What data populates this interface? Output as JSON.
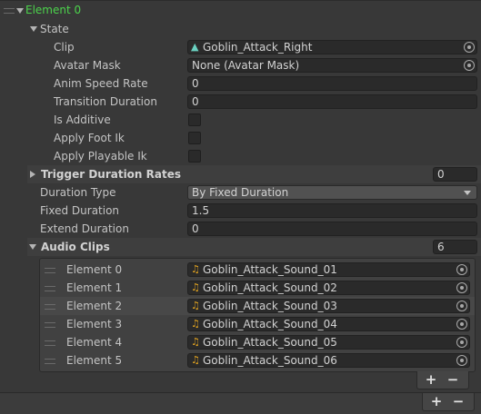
{
  "element": {
    "label": "Element 0",
    "color": "#4cd44c"
  },
  "state": {
    "label": "State",
    "clip": {
      "label": "Clip",
      "value": "Goblin_Attack_Right",
      "icon": "animation-clip-icon"
    },
    "avatar_mask": {
      "label": "Avatar Mask",
      "value": "None (Avatar Mask)"
    },
    "anim_speed_rate": {
      "label": "Anim Speed Rate",
      "value": "0"
    },
    "transition_duration": {
      "label": "Transition Duration",
      "value": "0"
    },
    "is_additive": {
      "label": "Is Additive",
      "checked": false
    },
    "apply_foot_ik": {
      "label": "Apply Foot Ik",
      "checked": false
    },
    "apply_playable_ik": {
      "label": "Apply Playable Ik",
      "checked": false
    }
  },
  "trigger_duration_rates": {
    "label": "Trigger Duration Rates",
    "count": "0"
  },
  "duration_type": {
    "label": "Duration Type",
    "value": "By Fixed Duration"
  },
  "fixed_duration": {
    "label": "Fixed Duration",
    "value": "1.5"
  },
  "extend_duration": {
    "label": "Extend Duration",
    "value": "0"
  },
  "audio_clips": {
    "label": "Audio Clips",
    "count": "6",
    "icon": "audio-clip-icon",
    "items": [
      {
        "label": "Element 0",
        "value": "Goblin_Attack_Sound_01"
      },
      {
        "label": "Element 1",
        "value": "Goblin_Attack_Sound_02"
      },
      {
        "label": "Element 2",
        "value": "Goblin_Attack_Sound_03"
      },
      {
        "label": "Element 3",
        "value": "Goblin_Attack_Sound_04"
      },
      {
        "label": "Element 4",
        "value": "Goblin_Attack_Sound_05"
      },
      {
        "label": "Element 5",
        "value": "Goblin_Attack_Sound_06"
      }
    ],
    "add_label": "+",
    "remove_label": "−"
  },
  "outer_list": {
    "add_label": "+",
    "remove_label": "−"
  }
}
